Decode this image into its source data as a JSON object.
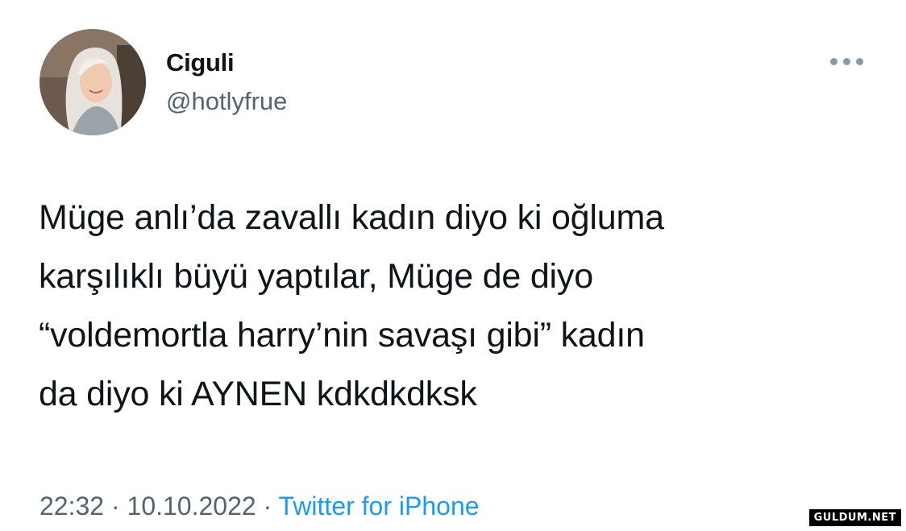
{
  "author": {
    "display_name": "Ciguli",
    "handle": "@hotlyfrue",
    "avatar": "profile-photo"
  },
  "more_icon": "more-horizontal-icon",
  "tweet": {
    "text": "Müge anlı’da zavallı kadın diyo ki oğluma\nkarşılıklı büyü yaptılar, Müge de diyo\n“voldemortla harry’nin savaşı gibi” kadın\nda diyo ki AYNEN kdkdkdksk"
  },
  "meta": {
    "time": "22:32",
    "separator": "·",
    "date": "10.10.2022",
    "source": "Twitter for iPhone"
  },
  "watermark": "GULDUM.NET",
  "colors": {
    "text": "#0f1419",
    "secondary": "#536471",
    "link": "#1d9bf0",
    "background": "#ffffff"
  }
}
